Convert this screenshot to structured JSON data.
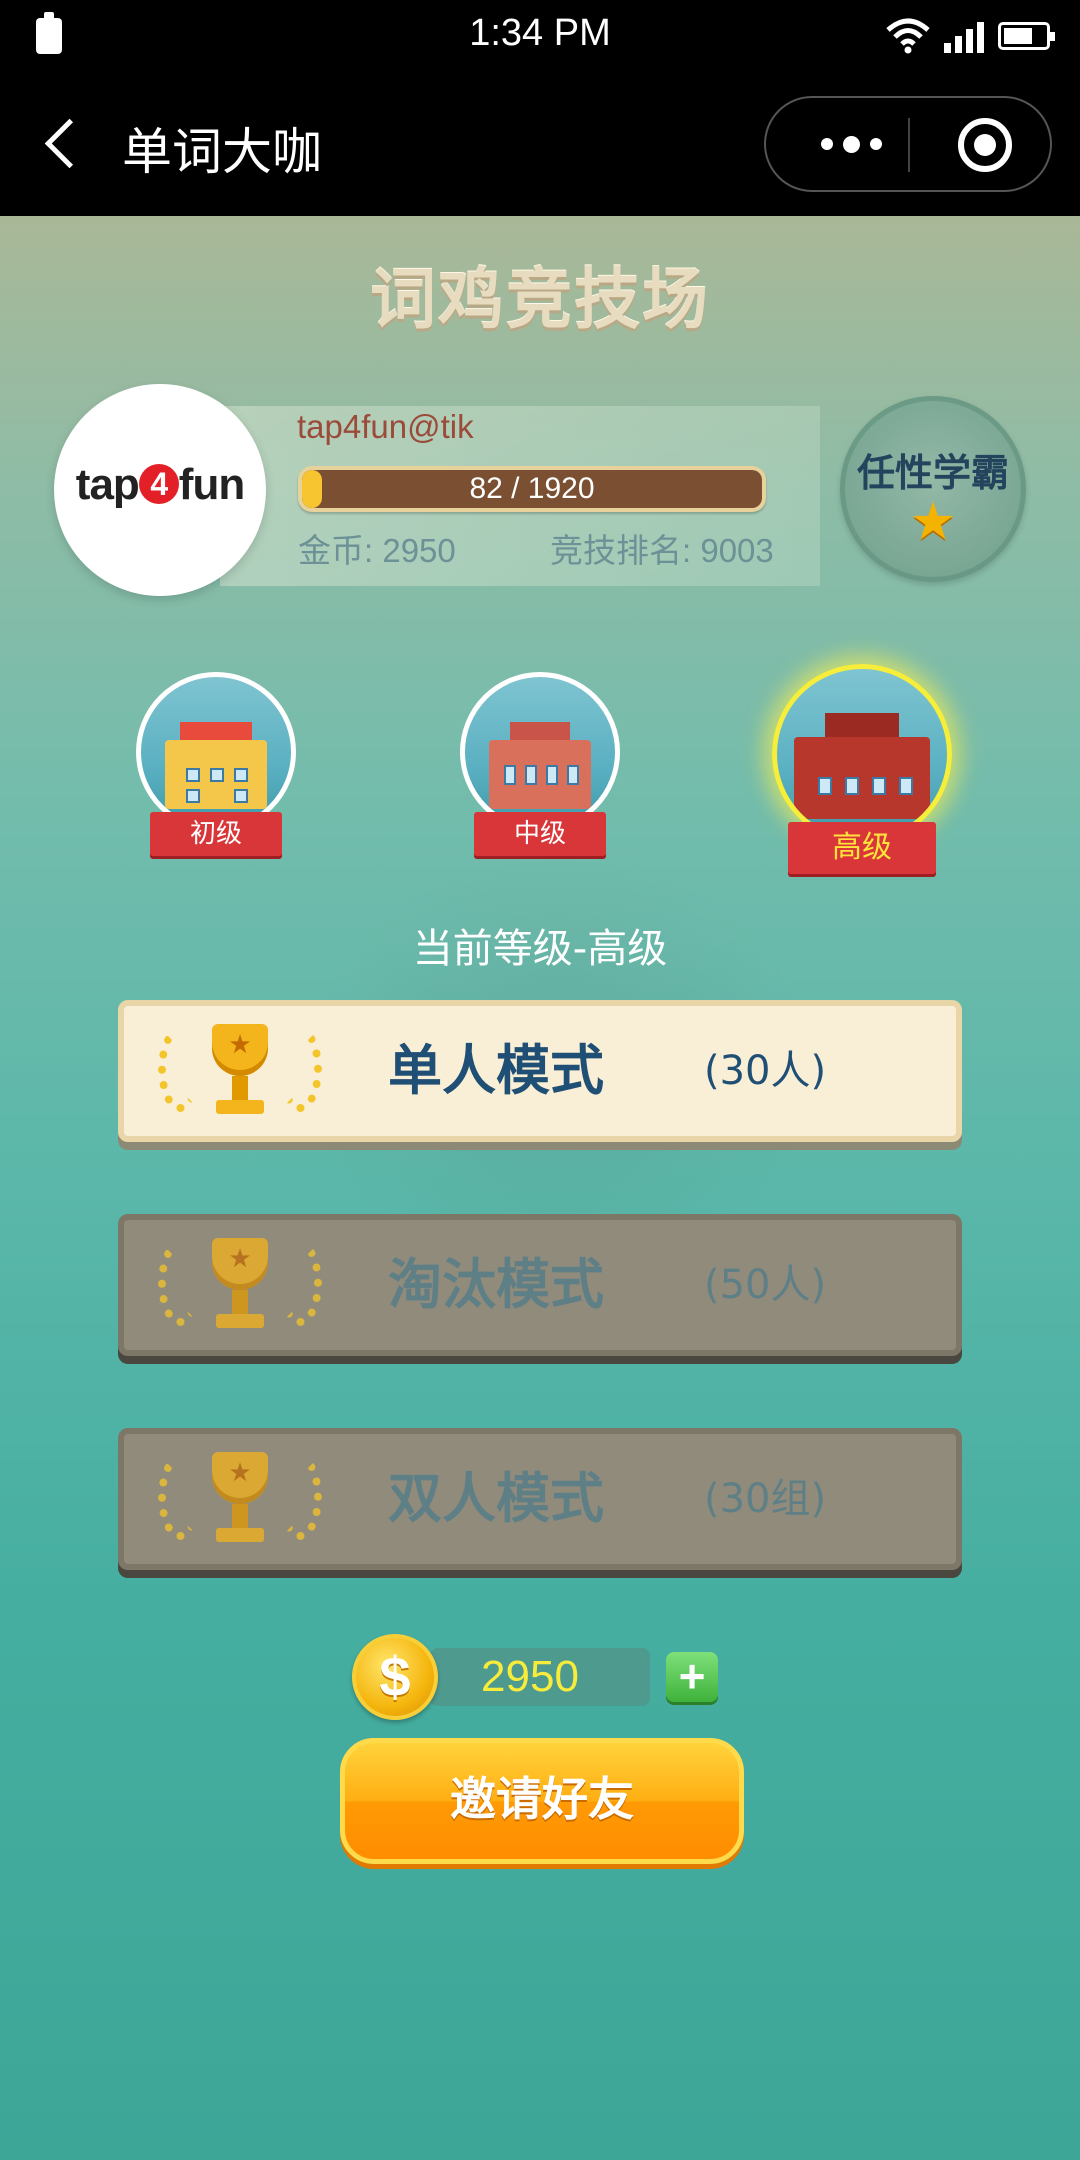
{
  "status_bar": {
    "time": "1:34 PM"
  },
  "nav": {
    "title": "单词大咖"
  },
  "arena": {
    "title": "词鸡竞技场"
  },
  "profile": {
    "username": "tap4fun@tik",
    "avatar_logo_left": "tap",
    "avatar_logo_num": "4",
    "avatar_logo_right": "fun",
    "xp_current": 82,
    "xp_total": 1920,
    "xp_text": "82 / 1920",
    "coins_text": "金币: 2950",
    "rank_text": "竞技排名: 9003",
    "badge_label": "任性学霸",
    "badge_star": "★"
  },
  "levels": [
    {
      "label": "初级",
      "active": false
    },
    {
      "label": "中级",
      "active": false
    },
    {
      "label": "高级",
      "active": true
    }
  ],
  "current_level": "当前等级-高级",
  "modes": [
    {
      "name": "单人模式",
      "count": "(30人)",
      "enabled": true
    },
    {
      "name": "淘汰模式",
      "count": "(50人)",
      "enabled": false
    },
    {
      "name": "双人模式",
      "count": "(30组)",
      "enabled": false
    }
  ],
  "wallet": {
    "coin_symbol": "$",
    "coins": "2950",
    "plus": "+"
  },
  "invite_label": "邀请好友",
  "colors": {
    "accent_orange": "#ff9a05",
    "coin_text": "#f7ec3c",
    "mode_text": "#1f4f74"
  }
}
